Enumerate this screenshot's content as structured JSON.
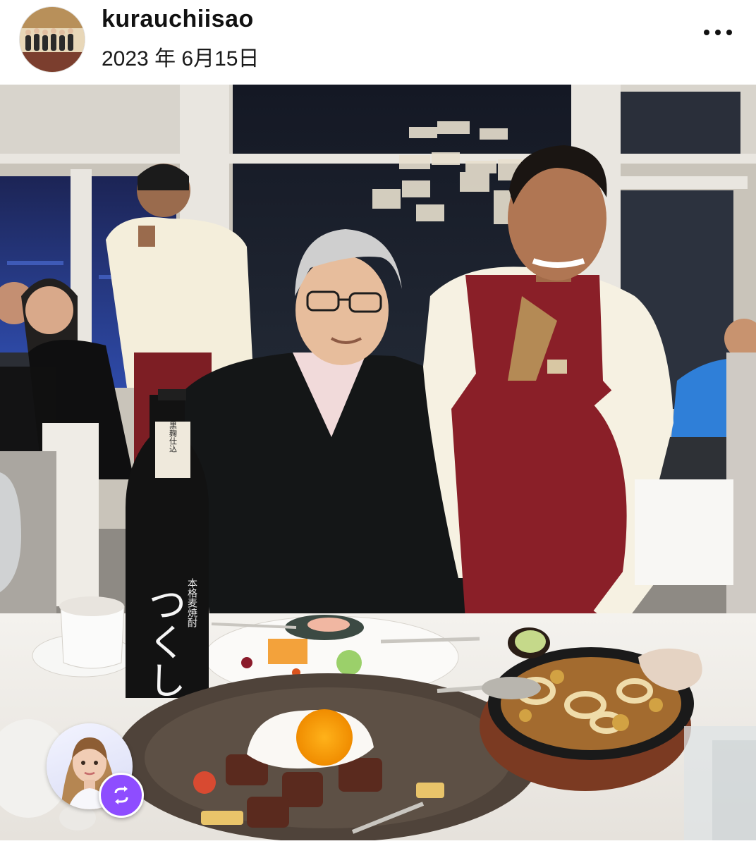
{
  "post": {
    "username": "kurauchiisao",
    "date": "2023 年 6月15日",
    "more_icon": "more-horizontal-icon"
  },
  "photo": {
    "bottle": {
      "label_top": "黒麹仕込",
      "label_side": "本格麦焼酎",
      "brand": "つくし"
    }
  },
  "overlay": {
    "creator_icon": "avatar-3d-icon",
    "remix_icon": "repost-arrows-icon"
  },
  "colors": {
    "remix": "#8e4dff",
    "text": "#111111"
  }
}
